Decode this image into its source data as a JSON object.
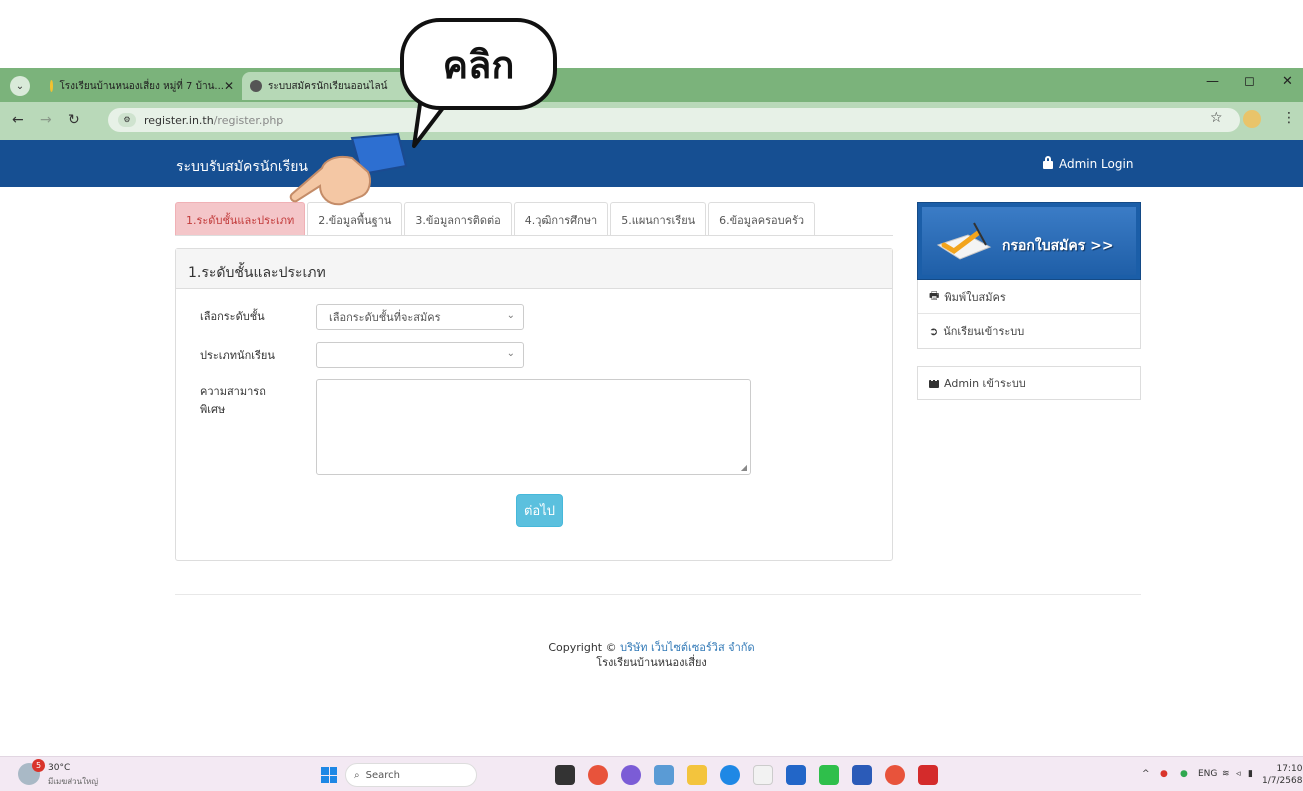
{
  "browser": {
    "tabs": [
      {
        "title": "โรงเรียนบ้านหนองเสี่ยง หมู่ที่ 7 บ้าน...",
        "close": "✕"
      },
      {
        "title": "ระบบสมัครนักเรียนออนไลน์",
        "close": ""
      }
    ],
    "url_host": "register.in.th",
    "url_path": "/register.php",
    "window_controls": [
      "—",
      "◻",
      "✕"
    ],
    "nav_icons": [
      "back-icon",
      "forward-icon",
      "reload-icon"
    ]
  },
  "site": {
    "brand": "ระบบรับสมัครนักเรียน",
    "admin_login": "Admin Login"
  },
  "form_tabs": [
    {
      "label": "1.ระดับชั้นและประเภท",
      "active": true
    },
    {
      "label": "2.ข้อมูลพื้นฐาน",
      "active": false
    },
    {
      "label": "3.ข้อมูลการติดต่อ",
      "active": false
    },
    {
      "label": "4.วุฒิการศึกษา",
      "active": false
    },
    {
      "label": "5.แผนการเรียน",
      "active": false
    },
    {
      "label": "6.ข้อมูลครอบครัว",
      "active": false
    }
  ],
  "panel": {
    "title": "1.ระดับชั้นและประเภท",
    "level_label": "เลือกระดับชั้น",
    "level_value": "เลือกระดับชั้นที่จะสมัคร",
    "type_label": "ประเภทนักเรียน",
    "type_value": "",
    "ability_label_line1": "ความสามารถ",
    "ability_label_line2": "พิเศษ",
    "next_button": "ต่อไป"
  },
  "sidebar": {
    "banner_text": "กรอกใบสมัคร >>",
    "items": [
      {
        "label": "พิมพ์ใบสมัคร",
        "icon": "printer-icon"
      },
      {
        "label": "นักเรียนเข้าระบบ",
        "icon": "login-icon"
      }
    ],
    "admin_item": "Admin เข้าระบบ"
  },
  "footer": {
    "copyright_prefix": "Copyright ©",
    "company": "บริษัท เว็บไซต์เซอร์วิส จำกัด",
    "school": "โรงเรียนบ้านหนองเสี่ยง"
  },
  "callout": {
    "text": "คลิก"
  },
  "taskbar": {
    "weather_temp": "30°C",
    "weather_badge": "5",
    "weather_cond": "มีเมฆส่วนใหญ่",
    "search_placeholder": "Search",
    "lang": "ENG",
    "time": "17:10",
    "date": "1/7/2568"
  },
  "colors": {
    "navbar": "#164f92",
    "browser_frame": "#7bb37b",
    "active_tab_bg": "#f4c6c9",
    "next_button": "#5bc0de"
  }
}
